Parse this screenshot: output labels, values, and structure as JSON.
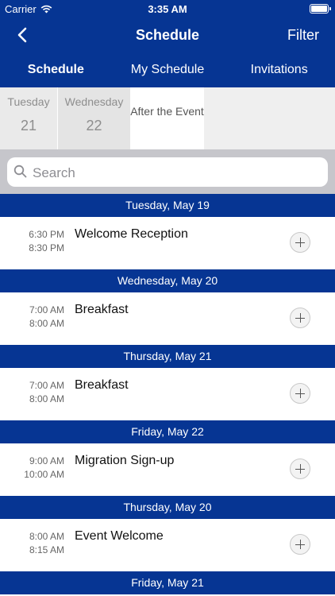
{
  "status": {
    "carrier": "Carrier",
    "time": "3:35 AM"
  },
  "nav": {
    "title": "Schedule",
    "filter": "Filter"
  },
  "tabs": [
    {
      "label": "Schedule",
      "active": true
    },
    {
      "label": "My Schedule",
      "active": false
    },
    {
      "label": "Invitations",
      "active": false
    }
  ],
  "days": [
    {
      "name": "Tuesday",
      "num": "21"
    },
    {
      "name": "Wednesday",
      "num": "22"
    },
    {
      "name": "After the Event"
    }
  ],
  "search": {
    "placeholder": "Search"
  },
  "sections": [
    {
      "header": "Tuesday, May 19",
      "items": [
        {
          "start": "6:30 PM",
          "end": "8:30 PM",
          "name": "Welcome Reception"
        }
      ]
    },
    {
      "header": "Wednesday, May 20",
      "items": [
        {
          "start": "7:00 AM",
          "end": "8:00 AM",
          "name": "Breakfast"
        }
      ]
    },
    {
      "header": "Thursday, May 21",
      "items": [
        {
          "start": "7:00 AM",
          "end": "8:00 AM",
          "name": "Breakfast"
        }
      ]
    },
    {
      "header": "Friday, May 22",
      "items": [
        {
          "start": "9:00 AM",
          "end": "10:00 AM",
          "name": "Migration Sign-up"
        }
      ]
    },
    {
      "header": "Thursday, May 20",
      "items": [
        {
          "start": "8:00 AM",
          "end": "8:15 AM",
          "name": "Event Welcome"
        }
      ]
    },
    {
      "header": "Friday, May 21",
      "items": []
    }
  ],
  "colors": {
    "primary": "#063593",
    "strip": "#efefef",
    "searchBar": "#c6c6cb"
  }
}
